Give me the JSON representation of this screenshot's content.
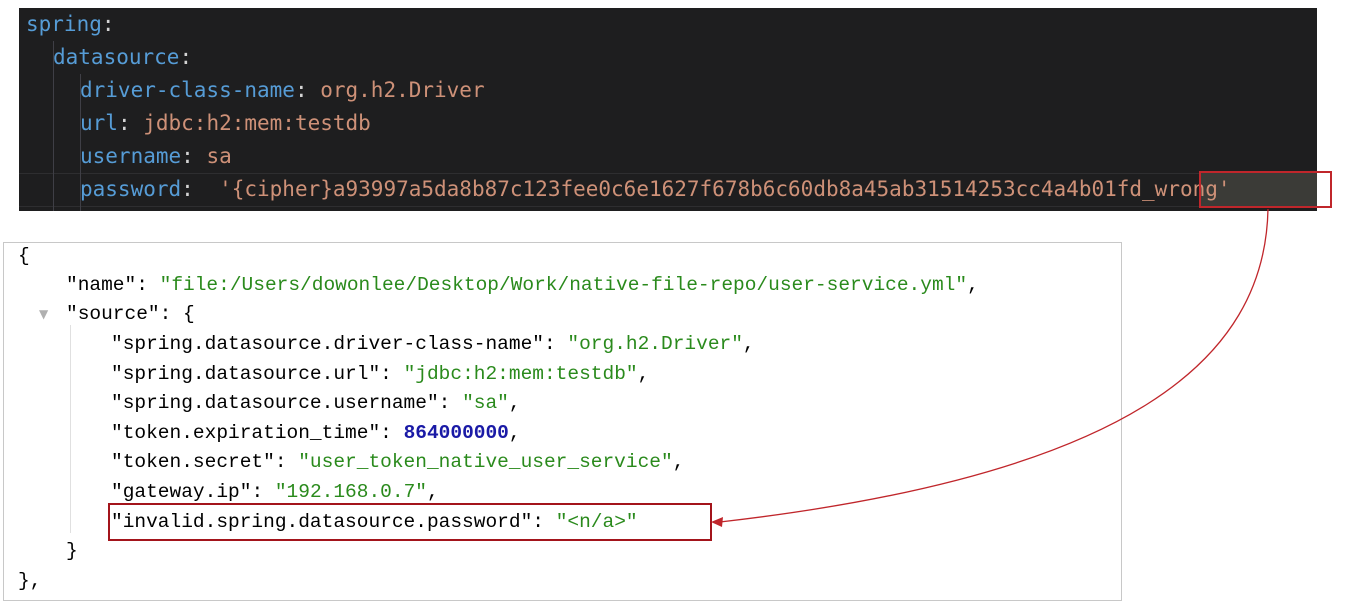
{
  "yaml": {
    "lines": [
      {
        "key": "spring",
        "sep": ":",
        "value": ""
      },
      {
        "key": "datasource",
        "sep": ":",
        "value": ""
      },
      {
        "key": "driver-class-name",
        "sep": ": ",
        "value": "org.h2.Driver"
      },
      {
        "key": "url",
        "sep": ": ",
        "value": "jdbc:h2:mem:testdb"
      },
      {
        "key": "username",
        "sep": ": ",
        "value": "sa"
      },
      {
        "key": "password",
        "sep": ":  ",
        "value": "'{cipher}a93997a5da8b87c123fee0c6e1627f678b6c60db8a45ab31514253cc4a4b01fd_wrong'"
      }
    ]
  },
  "json": {
    "open_brace": "{",
    "name_key": "\"name\"",
    "name_value": "\"file:/Users/dowonlee/Desktop/Work/native-file-repo/user-service.yml\"",
    "source_key": "\"source\"",
    "source_open": ": {",
    "toggle_glyph": "▼",
    "entries": [
      {
        "key": "\"spring.datasource.driver-class-name\"",
        "value": "\"org.h2.Driver\"",
        "type": "string"
      },
      {
        "key": "\"spring.datasource.url\"",
        "value": "\"jdbc:h2:mem:testdb\"",
        "type": "string"
      },
      {
        "key": "\"spring.datasource.username\"",
        "value": "\"sa\"",
        "type": "string"
      },
      {
        "key": "\"token.expiration_time\"",
        "value": "864000000",
        "type": "number"
      },
      {
        "key": "\"token.secret\"",
        "value": "\"user_token_native_user_service\"",
        "type": "string"
      },
      {
        "key": "\"gateway.ip\"",
        "value": "\"192.168.0.7\"",
        "type": "string"
      },
      {
        "key": "\"invalid.spring.datasource.password\"",
        "value": "\"<n/a>\"",
        "type": "string"
      }
    ],
    "inner_close": "}",
    "outer_close": "},"
  },
  "colors": {
    "highlight_border": "#c0262b",
    "arrow": "#c0262b",
    "yaml_key": "#569cd6",
    "yaml_value": "#ce9178",
    "json_string": "#2a8a1c",
    "json_number": "#1a1aa6"
  }
}
